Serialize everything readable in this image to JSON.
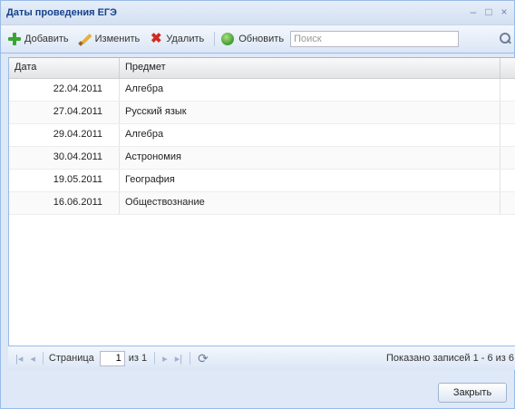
{
  "window": {
    "title": "Даты проведения ЕГЭ",
    "minimize_glyph": "–",
    "maximize_glyph": "□",
    "close_glyph": "×"
  },
  "toolbar": {
    "add_label": "Добавить",
    "edit_label": "Изменить",
    "delete_label": "Удалить",
    "refresh_label": "Обновить",
    "search_placeholder": "Поиск",
    "search_value": ""
  },
  "icons": {
    "add": "plus-icon",
    "edit": "pencil-icon",
    "delete": "delete-icon",
    "refresh": "refresh-icon",
    "search": "search-icon"
  },
  "grid": {
    "columns": {
      "date": "Дата",
      "subject": "Предмет"
    },
    "rows": [
      {
        "date": "22.04.2011",
        "subject": "Алгебра"
      },
      {
        "date": "27.04.2011",
        "subject": "Русский язык"
      },
      {
        "date": "29.04.2011",
        "subject": "Алгебра"
      },
      {
        "date": "30.04.2011",
        "subject": "Астрономия"
      },
      {
        "date": "19.05.2011",
        "subject": "География"
      },
      {
        "date": "16.06.2011",
        "subject": "Обществознание"
      }
    ]
  },
  "pager": {
    "first": "|◂",
    "prev": "◂",
    "page_label": "Страница",
    "page_value": "1",
    "of_label": "из 1",
    "next": "▸",
    "last": "▸|",
    "refresh_glyph": "⟳",
    "info": "Показано записей 1 - 6 из 6"
  },
  "footer": {
    "close_label": "Закрыть"
  },
  "colors": {
    "window_bg": "#dfe8f6",
    "border": "#99bbe8",
    "title_text": "#15428b"
  }
}
